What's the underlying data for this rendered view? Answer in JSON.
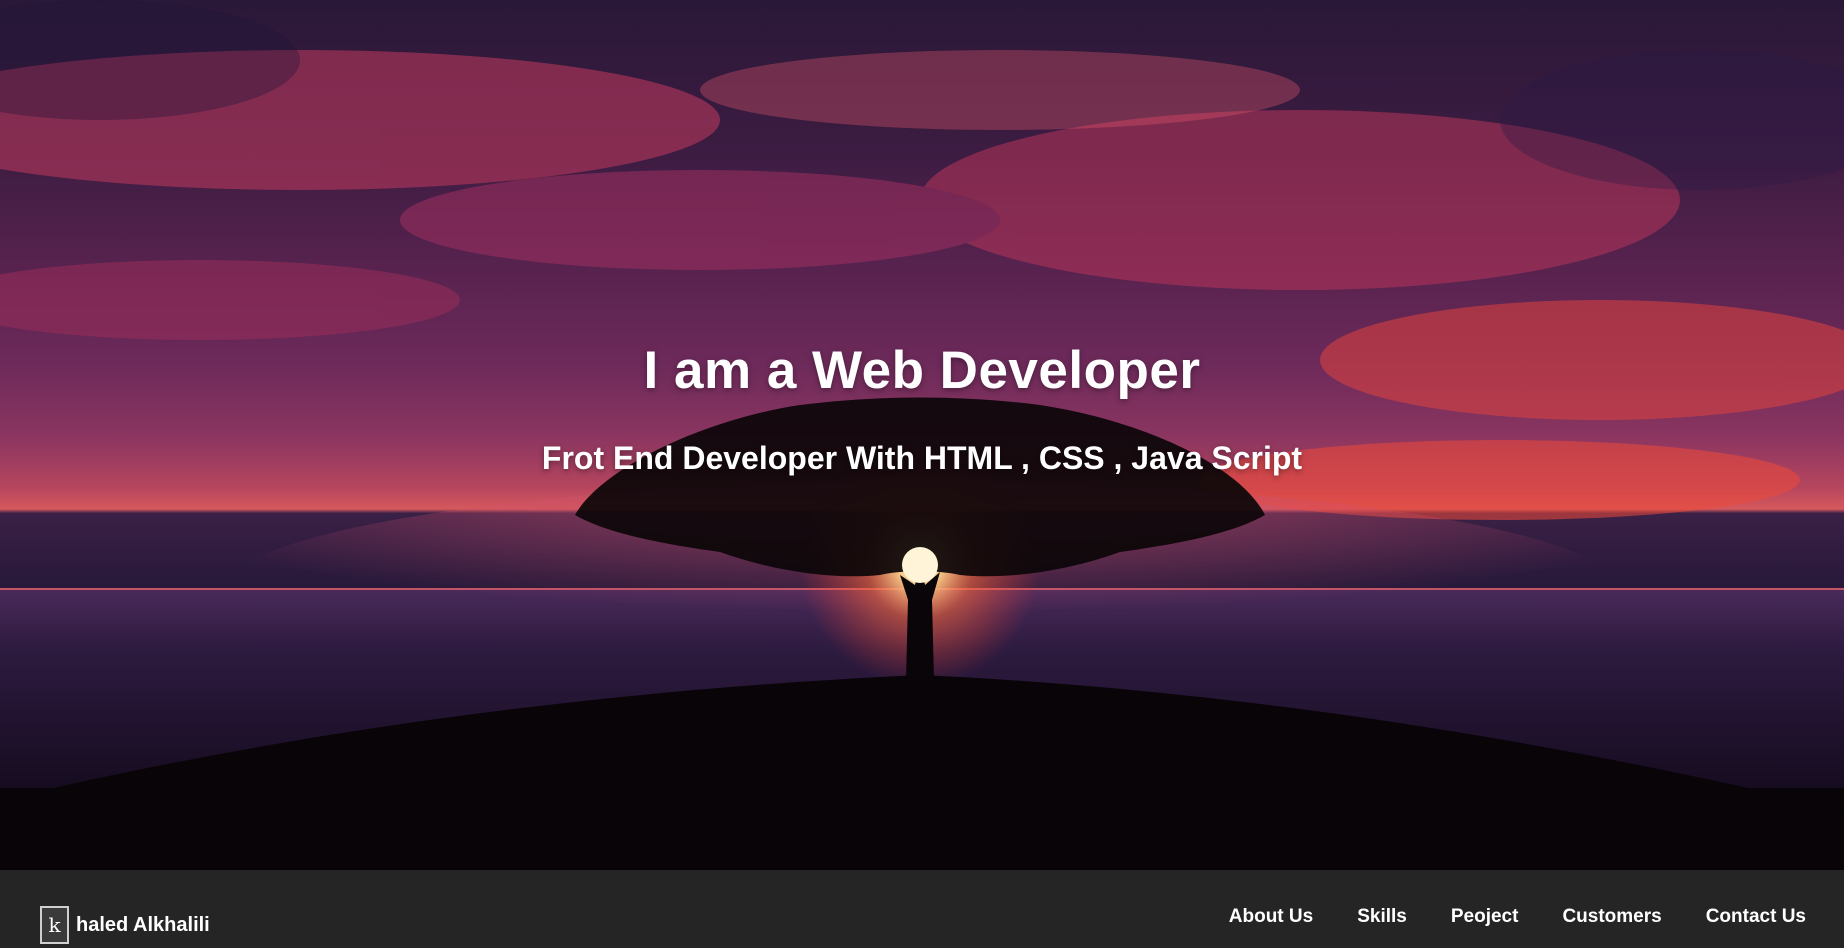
{
  "hero": {
    "headline": "I am a Web Developer",
    "subheadline": "Frot End Developer With HTML , CSS , Java Script"
  },
  "navbar": {
    "logo_letter": "k",
    "logo_name": "haled Alkhalili",
    "links": [
      "About Us",
      "Skills",
      "Peoject",
      "Customers",
      "Contact Us"
    ]
  },
  "colors": {
    "navbar_bg": "#252525",
    "text": "#ffffff",
    "sky_accent": "#d5585c"
  }
}
